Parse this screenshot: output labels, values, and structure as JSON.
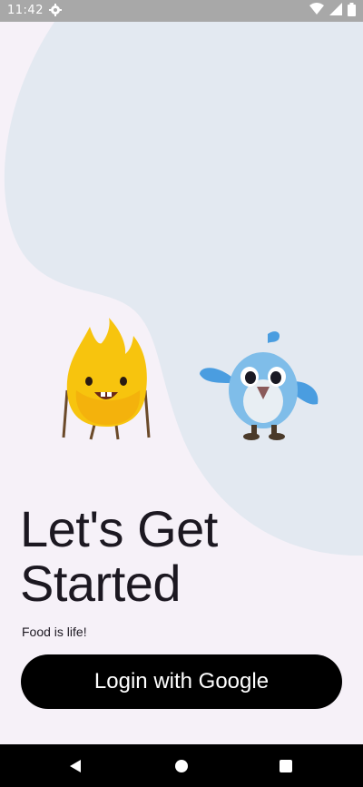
{
  "status_bar": {
    "time": "11:42",
    "icons": [
      "settings-icon",
      "wifi-icon",
      "signal-icon",
      "battery-icon"
    ]
  },
  "illustration": {
    "characters": [
      "fire-mascot",
      "blue-bird-mascot"
    ]
  },
  "main": {
    "title_line1": "Let's Get",
    "title_line2": "Started",
    "subtitle": "Food is life!",
    "login_button_label": "Login with Google"
  },
  "nav_bar": {
    "icons": [
      "back-icon",
      "home-icon",
      "recents-icon"
    ]
  },
  "colors": {
    "background": "#f6f1f8",
    "blob": "#e3e9f1",
    "button": "#000000",
    "button_text": "#ffffff",
    "text": "#1c1821",
    "status_bar": "#a8a8a8",
    "nav_bar": "#000000"
  }
}
